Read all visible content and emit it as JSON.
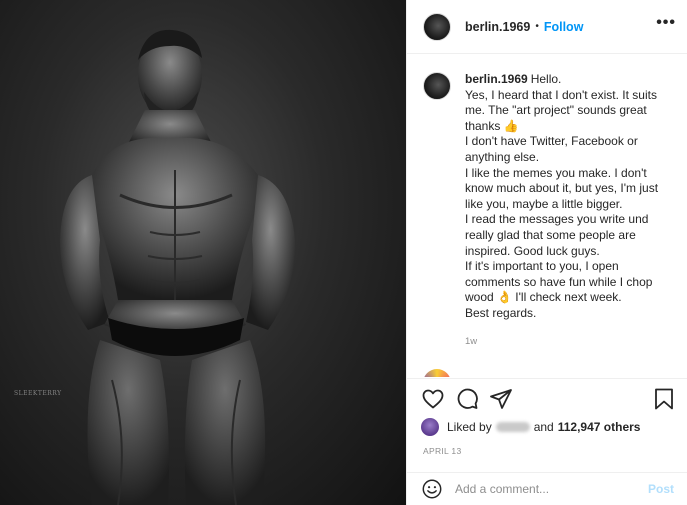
{
  "post": {
    "photo_watermark": "SLEEKTERRY",
    "header": {
      "username": "berlin.1969",
      "separator": "•",
      "follow_label": "Follow",
      "more_label": "•••"
    },
    "caption": {
      "username": "berlin.1969",
      "lines": [
        "Hello.",
        "Yes, I heard that I don't exist. It suits",
        "me. The \"art project\" sounds great",
        "thanks 👍",
        "I don't have Twitter, Facebook or",
        "anything else.",
        "I like the memes you make. I don't",
        "know much about it, but yes, I'm just",
        "like you, maybe a little bigger.",
        "I read the messages you write und",
        "really glad that some people are",
        "inspired. Good luck guys.",
        "If it's important to you, I open",
        "comments so have fun while I chop",
        "wood 👌 I'll check next week.",
        "Best regards."
      ],
      "time": "1w"
    },
    "likes": {
      "prefix": "Liked by",
      "suffix": "and",
      "others": "112,947 others"
    },
    "date": "APRIL 13",
    "comment_box": {
      "placeholder": "Add a comment...",
      "post_label": "Post"
    },
    "icons": {
      "like": "heart-icon",
      "comment": "comment-icon",
      "share": "paper-plane-icon",
      "save": "bookmark-icon",
      "emoji": "smiley-icon"
    },
    "colors": {
      "link_blue": "#0095f6",
      "post_disabled": "#b2dffc",
      "muted_text": "#8e8e8e"
    }
  }
}
